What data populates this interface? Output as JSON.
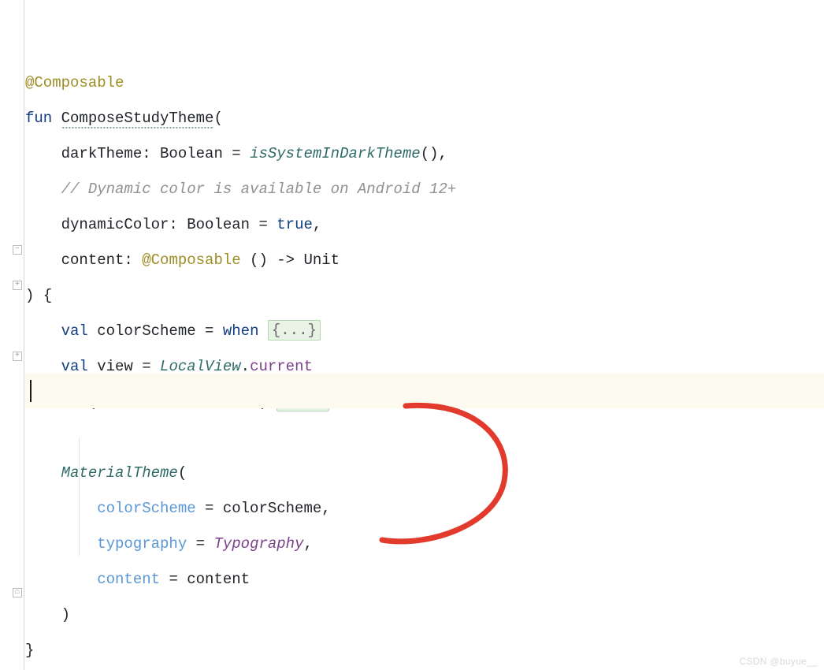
{
  "code": {
    "line1_annotation": "@Composable",
    "line2_fun": "fun ",
    "line2_name": "ComposeStudyTheme",
    "line2_paren": "(",
    "line3_indent": "    ",
    "line3_param": "darkTheme: Boolean = ",
    "line3_call": "isSystemInDarkTheme",
    "line3_tail": "(),",
    "line4_indent": "    ",
    "line4_comment": "// Dynamic color is available on Android 12+",
    "line5_indent": "    ",
    "line5_param": "dynamicColor: Boolean = ",
    "line5_true": "true",
    "line5_comma": ",",
    "line6_indent": "    ",
    "line6_a": "content: ",
    "line6_ann": "@Composable",
    "line6_b": " () -> Unit",
    "line7": ") {",
    "line8_indent": "    ",
    "line8_val": "val ",
    "line8_name": "colorScheme = ",
    "line8_when": "when",
    "line8_fold": "{...}",
    "line9_indent": "    ",
    "line9_val": "val ",
    "line9_name": "view = ",
    "line9_local": "LocalView",
    "line9_dot": ".",
    "line9_current": "current",
    "line10_indent": "    ",
    "line10_if": "if ",
    "line10_open": "(!view.",
    "line10_prop": "isInEditMode",
    "line10_close": ") ",
    "line10_fold": "{...}",
    "line12_indent": "    ",
    "line12_mat": "MaterialTheme",
    "line12_paren": "(",
    "line13_indent": "        ",
    "line13_named": "colorScheme",
    "line13_eq": " = colorScheme,",
    "line14_indent": "        ",
    "line14_named": "typography",
    "line14_eq": " = ",
    "line14_typo": "Typography",
    "line14_comma": ",",
    "line15_indent": "        ",
    "line15_named": "content",
    "line15_eq": " = content",
    "line16_indent": "    ",
    "line16_close": ")",
    "line17_close": "}"
  },
  "watermark": "CSDN @buyue__"
}
